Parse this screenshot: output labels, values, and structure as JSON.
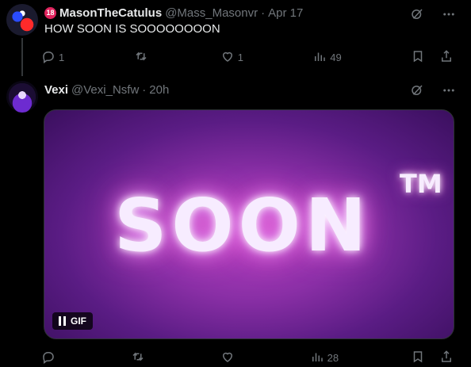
{
  "tweets": [
    {
      "display_name": "MasonTheCatulus",
      "badge": "18",
      "handle": "@Mass_Masonvr",
      "separator": "·",
      "time": "Apr 17",
      "text": "HOW SOON IS SOOOOOOOON",
      "actions": {
        "reply_count": "1",
        "retweet_count": "",
        "like_count": "1",
        "views_count": "49"
      }
    },
    {
      "display_name": "Vexi",
      "handle": "@Vexi_Nsfw",
      "separator": "·",
      "time": "20h",
      "media": {
        "gif_main_text": "SOON",
        "gif_tm_text": "TM",
        "gif_label": "GIF"
      },
      "actions": {
        "reply_count": "",
        "retweet_count": "",
        "like_count": "",
        "views_count": "28"
      }
    }
  ],
  "icons": {
    "grok": "grok-icon",
    "more": "more-icon",
    "reply": "reply-icon",
    "retweet": "retweet-icon",
    "like": "like-icon",
    "views": "views-icon",
    "bookmark": "bookmark-icon",
    "share": "share-icon",
    "pause": "pause-icon"
  },
  "colors": {
    "background": "#000000",
    "text_primary": "#e7e9ea",
    "text_secondary": "#71767b",
    "thread_line": "#333639",
    "gif_purple": "#8a2fa6"
  }
}
